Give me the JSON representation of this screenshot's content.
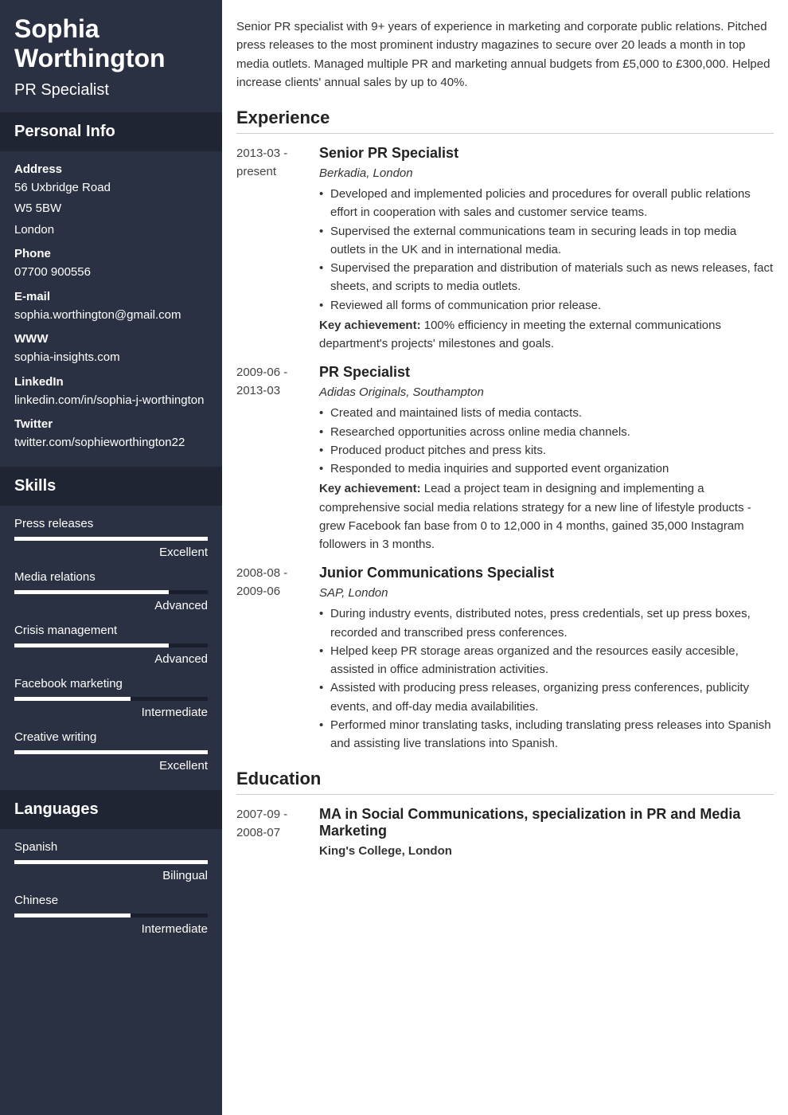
{
  "header": {
    "name": "Sophia Worthington",
    "title": "PR Specialist"
  },
  "sidebar": {
    "personal_info_heading": "Personal Info",
    "address_label": "Address",
    "address_line1": "56 Uxbridge Road",
    "address_line2": "W5 5BW",
    "address_line3": "London",
    "phone_label": "Phone",
    "phone_value": "07700 900556",
    "email_label": "E-mail",
    "email_value": "sophia.worthington@gmail.com",
    "www_label": "WWW",
    "www_value": "sophia-insights.com",
    "linkedin_label": "LinkedIn",
    "linkedin_value": "linkedin.com/in/sophia-j-worthington",
    "twitter_label": "Twitter",
    "twitter_value": "twitter.com/sophieworthington22",
    "skills_heading": "Skills",
    "skills": [
      {
        "name": "Press releases",
        "level": "Excellent",
        "width": "100%"
      },
      {
        "name": "Media relations",
        "level": "Advanced",
        "width": "80%"
      },
      {
        "name": "Crisis management",
        "level": "Advanced",
        "width": "80%"
      },
      {
        "name": "Facebook marketing",
        "level": "Intermediate",
        "width": "60%"
      },
      {
        "name": "Creative writing",
        "level": "Excellent",
        "width": "100%"
      }
    ],
    "languages_heading": "Languages",
    "languages": [
      {
        "name": "Spanish",
        "level": "Bilingual",
        "width": "100%"
      },
      {
        "name": "Chinese",
        "level": "Intermediate",
        "width": "60%"
      }
    ]
  },
  "main": {
    "summary": "Senior PR specialist with 9+ years of experience in marketing and corporate public relations. Pitched press releases to the most prominent industry magazines to secure over 20 leads a month in top media outlets. Managed multiple PR and marketing annual budgets from £5,000 to £300,000. Helped increase clients' annual sales by up to 40%.",
    "experience_heading": "Experience",
    "key_achievement_label": "Key achievement:",
    "experience": [
      {
        "date": "2013-03 - present",
        "title": "Senior PR Specialist",
        "subtitle": "Berkadia, London",
        "bullets": [
          "Developed and implemented policies and procedures for overall public relations effort in cooperation with sales and customer service teams.",
          "Supervised the external communications team in securing leads in top media outlets in the UK and in international media.",
          "Supervised the preparation and distribution of materials such as news releases, fact sheets, and scripts to media outlets.",
          "Reviewed all forms of communication prior release."
        ],
        "achievement": "100% efficiency in meeting the external communications department's projects' milestones and goals."
      },
      {
        "date": "2009-06 - 2013-03",
        "title": "PR Specialist",
        "subtitle": "Adidas Originals, Southampton",
        "bullets": [
          "Created and maintained lists of media contacts.",
          "Researched opportunities across online media channels.",
          "Produced product pitches and press kits.",
          "Responded to media inquiries and supported event organization"
        ],
        "achievement": "Lead a project team in designing and implementing a comprehensive social media relations strategy for a new line of lifestyle products - grew Facebook fan base from 0 to 12,000 in 4 months, gained 35,000 Instagram followers in 3 months."
      },
      {
        "date": "2008-08 - 2009-06",
        "title": "Junior Communications Specialist",
        "subtitle": "SAP, London",
        "bullets": [
          "During industry events, distributed notes, press credentials, set up press boxes, recorded and transcribed press conferences.",
          "Helped keep PR storage areas organized and the resources easily accesible, assisted in office administration activities.",
          "Assisted with producing press releases, organizing press conferences, publicity events, and off-day media availabilities.",
          "Performed minor translating tasks, including translating press releases into Spanish and assisting live translations into Spanish."
        ],
        "achievement": null
      }
    ],
    "education_heading": "Education",
    "education": [
      {
        "date": "2007-09 - 2008-07",
        "title": "MA in Social Communications, specialization in PR and Media Marketing",
        "subtitle": "King's College, London"
      }
    ]
  }
}
